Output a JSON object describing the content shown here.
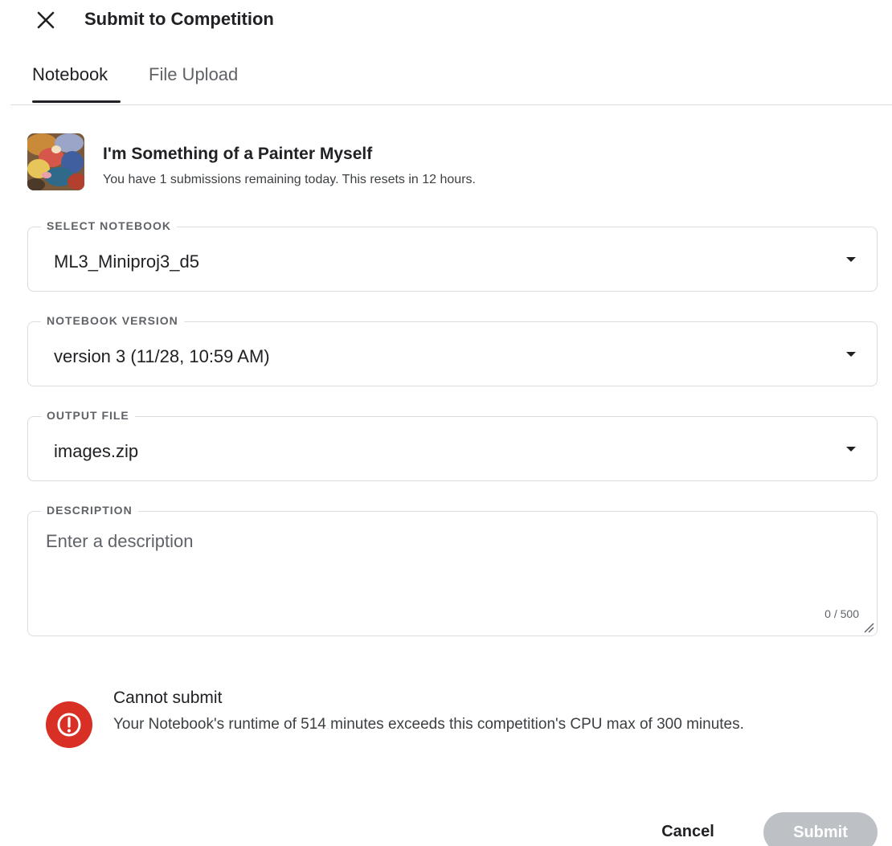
{
  "dialog": {
    "title": "Submit to Competition"
  },
  "tabs": [
    {
      "label": "Notebook",
      "active": true
    },
    {
      "label": "File Upload",
      "active": false
    }
  ],
  "competition": {
    "name": "I'm Something of a Painter Myself",
    "status": "You have 1 submissions remaining today. This resets in 12 hours."
  },
  "fields": {
    "notebook": {
      "label": "SELECT NOTEBOOK",
      "value": "ML3_Miniproj3_d5"
    },
    "version": {
      "label": "NOTEBOOK VERSION",
      "value": "version 3 (11/28, 10:59 AM)"
    },
    "output": {
      "label": "OUTPUT FILE",
      "value": "images.zip"
    },
    "description": {
      "label": "DESCRIPTION",
      "value": "",
      "placeholder": "Enter a description",
      "count": "0 / 500"
    }
  },
  "error": {
    "title": "Cannot submit",
    "message": "Your Notebook's runtime of 514 minutes exceeds this competition's CPU max of 300 minutes.",
    "color": "#d93025"
  },
  "buttons": {
    "cancel": "Cancel",
    "submit": "Submit",
    "submit_disabled": true
  },
  "icons": {
    "close": "close-icon",
    "dropdown": "chevron-down-icon",
    "error": "error-icon"
  }
}
